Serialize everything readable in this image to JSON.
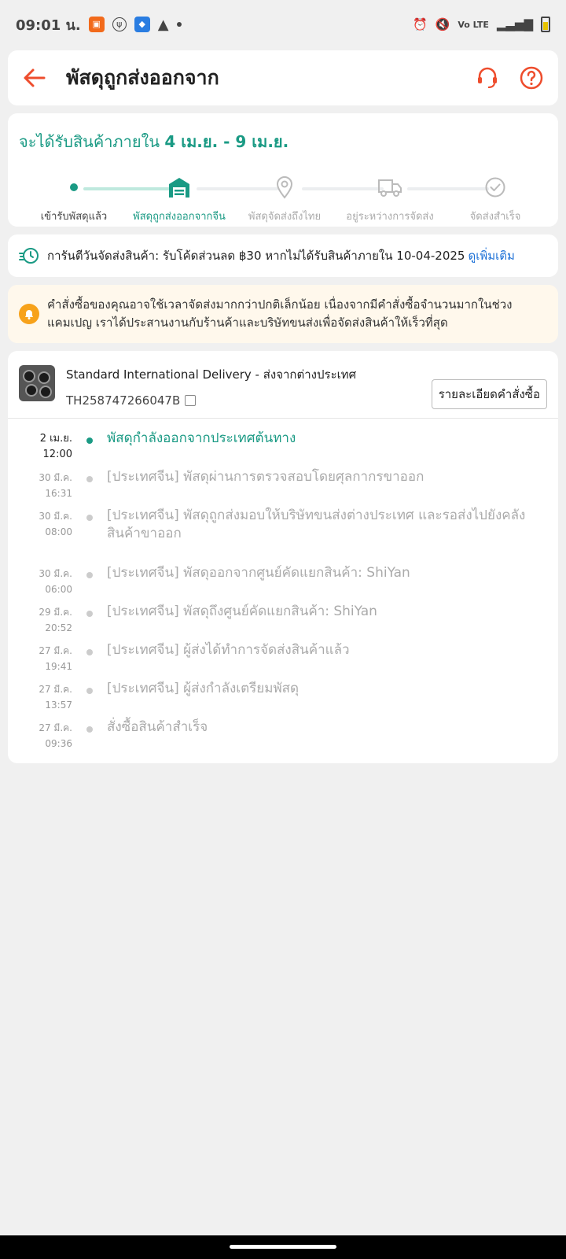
{
  "status_bar": {
    "time": "09:01 น.",
    "network": "Vo LTE"
  },
  "header": {
    "title": "พัสดุถูกส่งออกจาก"
  },
  "eta": {
    "prefix": "จะได้รับสินค้าภายใน",
    "range": "4 เม.ย. - 9 เม.ย."
  },
  "steps": [
    {
      "label": "เข้ารับพัสดุแล้ว",
      "state": "done"
    },
    {
      "label": "พัสดุถูกส่งออกจากจีน",
      "state": "current"
    },
    {
      "label": "พัสดุจัดส่งถึงไทย",
      "state": "pending"
    },
    {
      "label": "อยู่ระหว่างการจัดส่ง",
      "state": "pending"
    },
    {
      "label": "จัดส่งสำเร็จ",
      "state": "pending"
    }
  ],
  "guarantee": {
    "text": "การันตีวันจัดส่งสินค้า: รับโค้ดส่วนลด ฿30 หากไม่ได้รับสินค้าภายใน 10-04-2025",
    "more": "ดูเพิ่มเติม"
  },
  "notice": {
    "text": "คำสั่งซื้อของคุณอาจใช้เวลาจัดส่งมากกว่าปกติเล็กน้อย เนื่องจากมีคำสั่งซื้อจำนวนมากในช่วงแคมเปญ เราได้ประสานงานกับร้านค้าและบริษัทขนส่งเพื่อจัดส่งสินค้าให้เร็วที่สุด"
  },
  "shipment": {
    "service": "Standard International Delivery - ส่งจากต่างประเทศ",
    "tracking_no": "TH258747266047B",
    "detail_button": "รายละเอียดคำสั่งซื้อ"
  },
  "events": [
    {
      "date": "2 เม.ย.",
      "time": "12:00",
      "text": "พัสดุกำลังออกจากประเทศต้นทาง"
    },
    {
      "date": "30 มี.ค.",
      "time": "16:31",
      "text": "[ประเทศจีน] พัสดุผ่านการตรวจสอบโดยศุลกากรขาออก"
    },
    {
      "date": "30 มี.ค.",
      "time": "08:00",
      "text": "[ประเทศจีน] พัสดุถูกส่งมอบให้บริษัทขนส่งต่างประเทศ และรอส่งไปยังคลังสินค้าขาออก"
    },
    {
      "date": "30 มี.ค.",
      "time": "06:00",
      "text": "[ประเทศจีน] พัสดุออกจากศูนย์คัดแยกสินค้า: ShiYan"
    },
    {
      "date": "29 มี.ค.",
      "time": "20:52",
      "text": "[ประเทศจีน] พัสดุถึงศูนย์คัดแยกสินค้า: ShiYan"
    },
    {
      "date": "27 มี.ค.",
      "time": "19:41",
      "text": "[ประเทศจีน] ผู้ส่งได้ทำการจัดส่งสินค้าแล้ว"
    },
    {
      "date": "27 มี.ค.",
      "time": "13:57",
      "text": "[ประเทศจีน] ผู้ส่งกำลังเตรียมพัสดุ"
    },
    {
      "date": "27 มี.ค.",
      "time": "09:36",
      "text": "สั่งซื้อสินค้าสำเร็จ"
    }
  ],
  "colors": {
    "accent": "#1a9a84",
    "brand": "#ee4d2d",
    "link": "#1a6fd6",
    "notice_bg": "#fff8ec"
  }
}
